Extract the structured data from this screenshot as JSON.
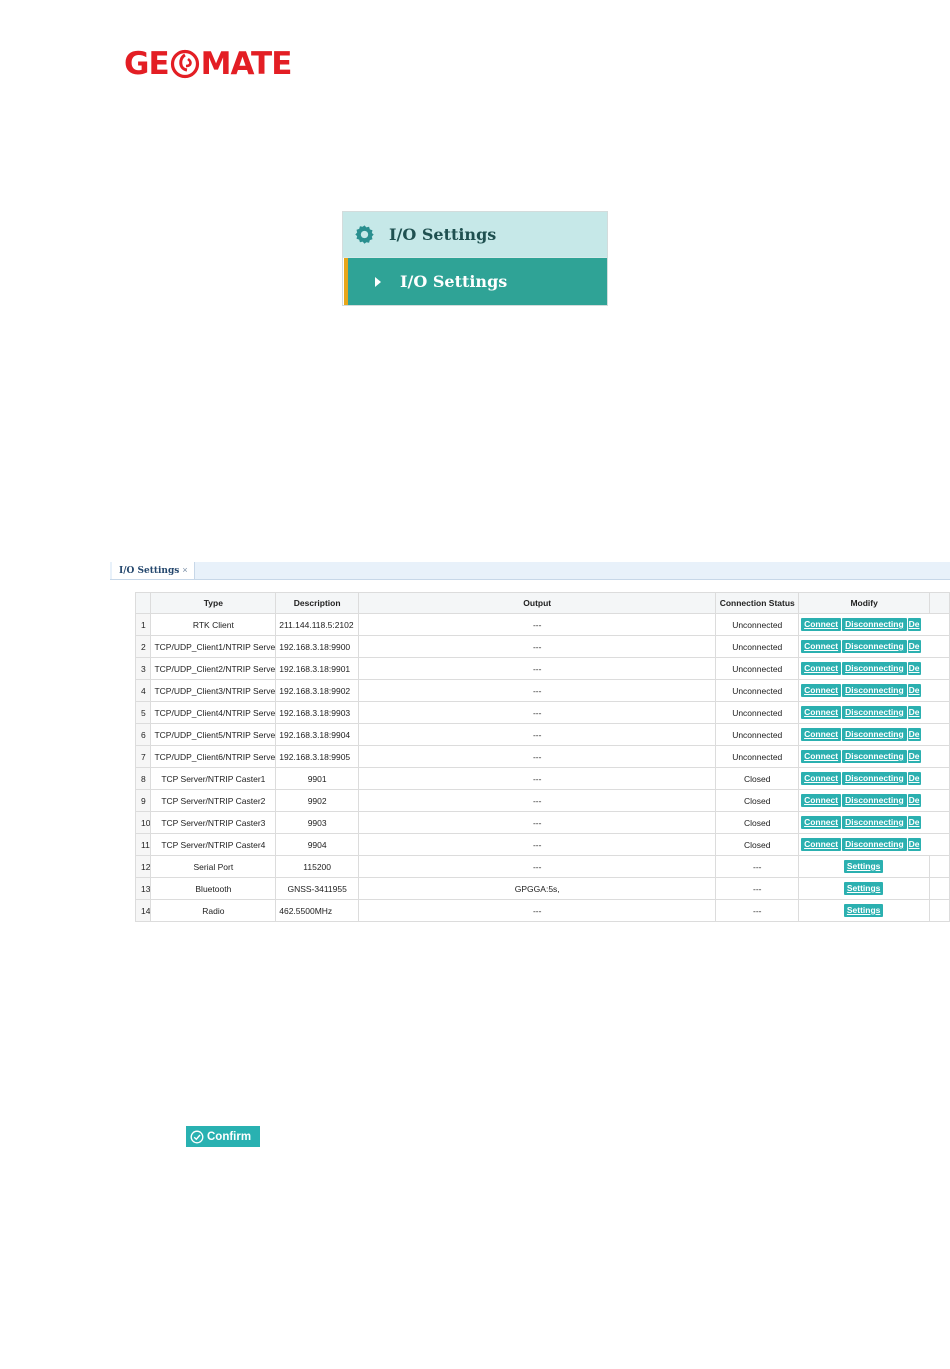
{
  "logo": {
    "text_left": "GE",
    "text_right": "MATE"
  },
  "menu": {
    "header_label": "I/O Settings",
    "item_label": "I/O Settings"
  },
  "io_panel": {
    "tab_label": "I/O Settings",
    "tab_close": "×",
    "columns": [
      "",
      "Type",
      "Description",
      "Output",
      "Connection Status",
      "Modify"
    ],
    "rows": [
      {
        "index": "1",
        "type": "RTK Client",
        "description": "211.144.118.5:2102",
        "output": "---",
        "status": "Unconnected",
        "buttons": [
          "Connect",
          "Disconnecting",
          "De"
        ]
      },
      {
        "index": "2",
        "type": "TCP/UDP_Client1/NTRIP Serve",
        "description": "192.168.3.18:9900",
        "output": "---",
        "status": "Unconnected",
        "buttons": [
          "Connect",
          "Disconnecting",
          "De"
        ]
      },
      {
        "index": "3",
        "type": "TCP/UDP_Client2/NTRIP Serve",
        "description": "192.168.3.18:9901",
        "output": "---",
        "status": "Unconnected",
        "buttons": [
          "Connect",
          "Disconnecting",
          "De"
        ]
      },
      {
        "index": "4",
        "type": "TCP/UDP_Client3/NTRIP Serve",
        "description": "192.168.3.18:9902",
        "output": "---",
        "status": "Unconnected",
        "buttons": [
          "Connect",
          "Disconnecting",
          "De"
        ]
      },
      {
        "index": "5",
        "type": "TCP/UDP_Client4/NTRIP Serve",
        "description": "192.168.3.18:9903",
        "output": "---",
        "status": "Unconnected",
        "buttons": [
          "Connect",
          "Disconnecting",
          "De"
        ]
      },
      {
        "index": "6",
        "type": "TCP/UDP_Client5/NTRIP Serve",
        "description": "192.168.3.18:9904",
        "output": "---",
        "status": "Unconnected",
        "buttons": [
          "Connect",
          "Disconnecting",
          "De"
        ]
      },
      {
        "index": "7",
        "type": "TCP/UDP_Client6/NTRIP Serve",
        "description": "192.168.3.18:9905",
        "output": "---",
        "status": "Unconnected",
        "buttons": [
          "Connect",
          "Disconnecting",
          "De"
        ]
      },
      {
        "index": "8",
        "type": "TCP Server/NTRIP Caster1",
        "description": "9901",
        "output": "---",
        "status": "Closed",
        "buttons": [
          "Connect",
          "Disconnecting",
          "De"
        ]
      },
      {
        "index": "9",
        "type": "TCP Server/NTRIP Caster2",
        "description": "9902",
        "output": "---",
        "status": "Closed",
        "buttons": [
          "Connect",
          "Disconnecting",
          "De"
        ]
      },
      {
        "index": "10",
        "type": "TCP Server/NTRIP Caster3",
        "description": "9903",
        "output": "---",
        "status": "Closed",
        "buttons": [
          "Connect",
          "Disconnecting",
          "De"
        ]
      },
      {
        "index": "11",
        "type": "TCP Server/NTRIP Caster4",
        "description": "9904",
        "output": "---",
        "status": "Closed",
        "buttons": [
          "Connect",
          "Disconnecting",
          "De"
        ]
      },
      {
        "index": "12",
        "type": "Serial Port",
        "description": "115200",
        "output": "---",
        "status": "---",
        "buttons": [
          "Settings"
        ]
      },
      {
        "index": "13",
        "type": "Bluetooth",
        "description": "GNSS-3411955",
        "output": "GPGGA:5s,",
        "status": "---",
        "buttons": [
          "Settings"
        ]
      },
      {
        "index": "14",
        "type": "Radio",
        "description": "462.5500MHz",
        "output": "---",
        "status": "---",
        "buttons": [
          "Settings"
        ]
      }
    ]
  },
  "confirm_button": {
    "label": "Confirm"
  },
  "colors": {
    "brand_red": "#e31e24",
    "teal": "#2fa396",
    "button_teal": "#2bb0b0",
    "menu_header_bg": "#c6e8e8",
    "accent_orange": "#e7a61a"
  },
  "icons": {
    "menu_header": "gear-icon",
    "menu_item": "caret-right-icon",
    "confirm": "check-circle-icon"
  }
}
